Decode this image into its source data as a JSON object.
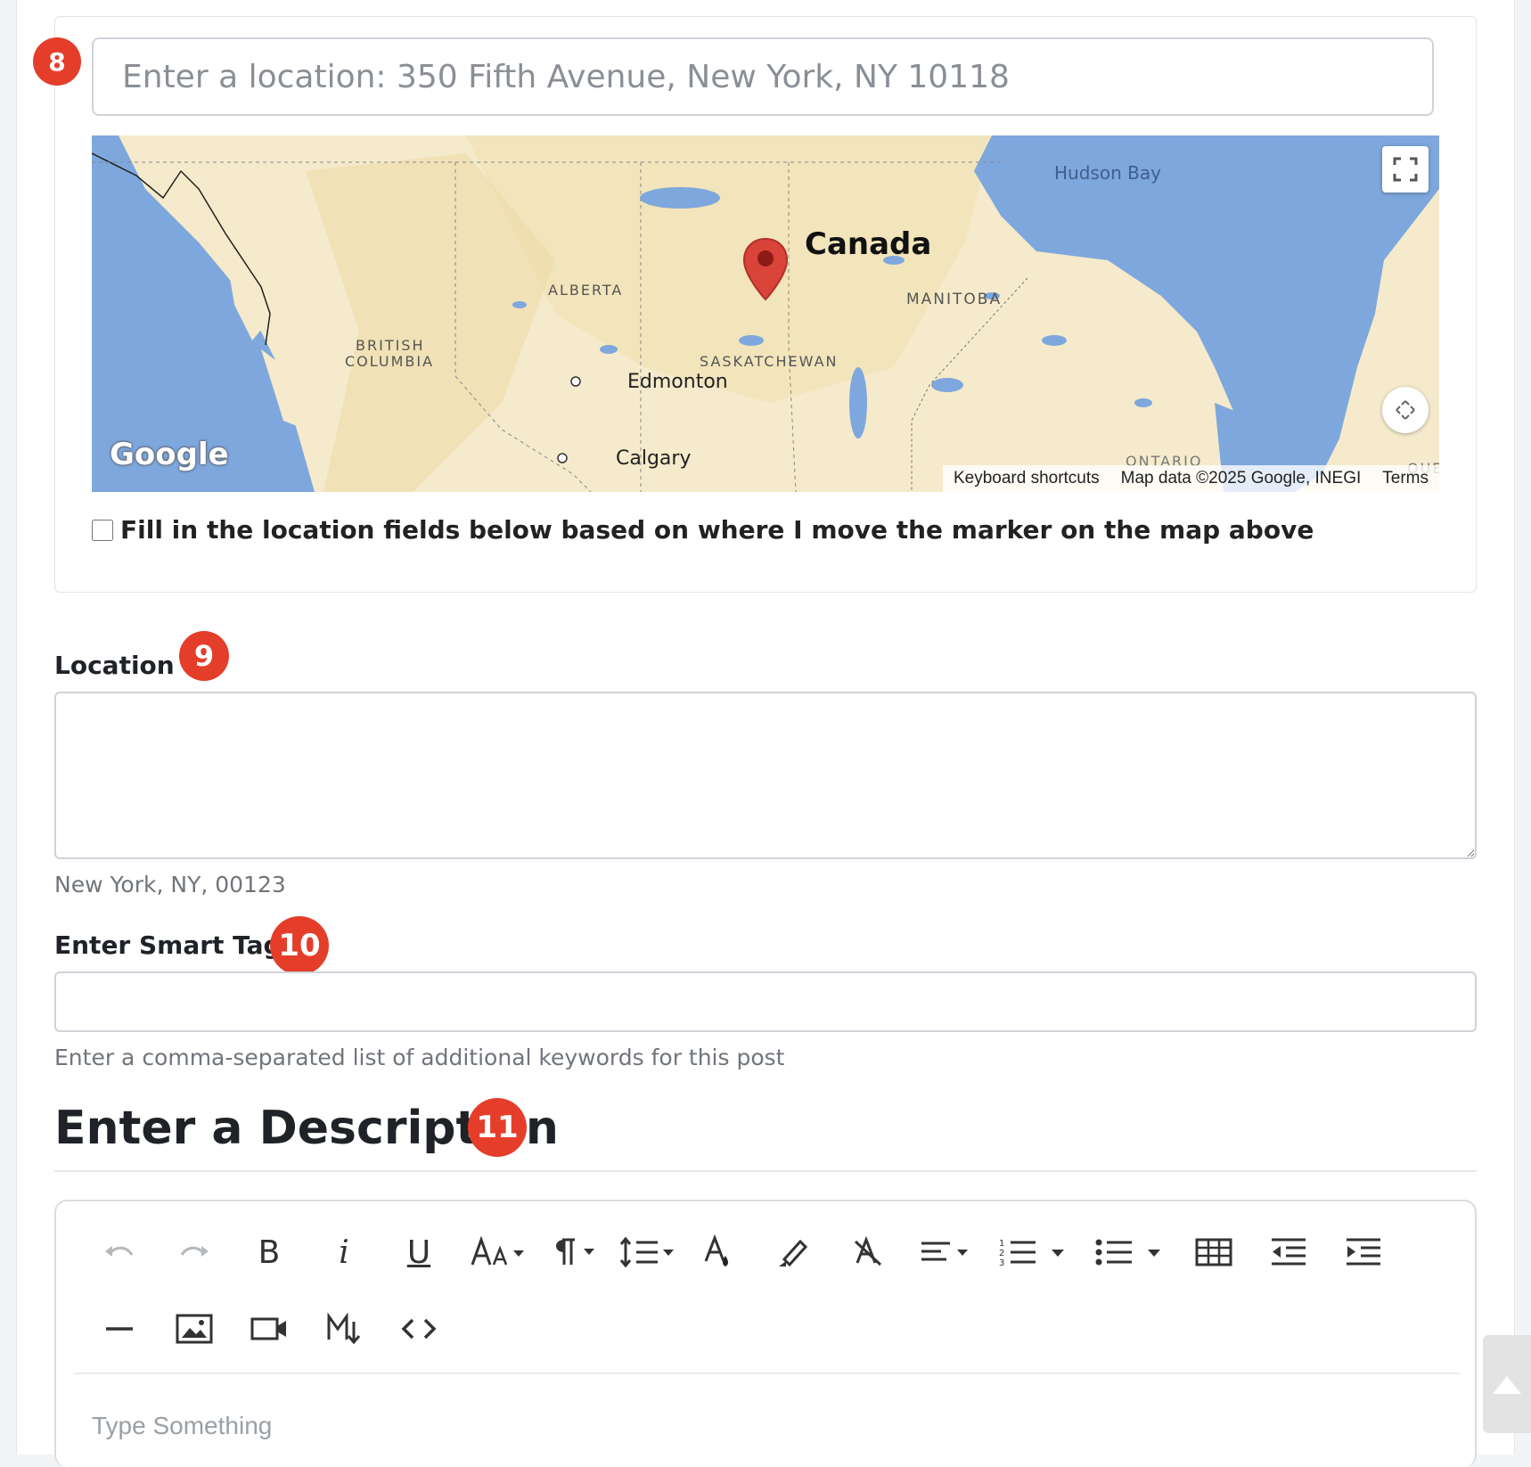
{
  "colors": {
    "accent_badge": "#e43e2b",
    "map_water": "#7ea7dd",
    "map_land": "#f5eacb",
    "marker": "#d9433a"
  },
  "map_section": {
    "step_badge": "8",
    "search_placeholder": "Enter a location: 350 Fifth Avenue, New York, NY 10118",
    "map_labels": {
      "hudson_bay": "Hudson Bay",
      "canada": "Canada",
      "alberta": "ALBERTA",
      "manitoba": "MANITOBA",
      "british_columbia_1": "BRITISH",
      "british_columbia_2": "COLUMBIA",
      "saskatchewan": "SASKATCHEWAN",
      "edmonton": "Edmonton",
      "calgary": "Calgary",
      "ontario": "ONTARIO",
      "quebec_partial": "QUE",
      "google_logo": "Google"
    },
    "attribution": {
      "keyboard_shortcuts": "Keyboard shortcuts",
      "map_data": "Map data ©2025 Google, INEGI",
      "terms": "Terms"
    },
    "icons": [
      "fullscreen-icon",
      "recenter-icon",
      "map-marker-icon"
    ],
    "checkbox_label": "Fill in the location fields below based on where I move the marker on the map above",
    "checkbox_checked": false
  },
  "location": {
    "label": "Location",
    "step_badge": "9",
    "value": "",
    "help": "New York, NY, 00123"
  },
  "smart_tags": {
    "label": "Enter Smart Tags",
    "step_badge": "10",
    "value": "",
    "help": "Enter a comma-separated list of additional keywords for this post"
  },
  "description": {
    "title": "Enter a Description",
    "step_badge": "11",
    "toolbar_icons": [
      "undo-icon",
      "redo-icon",
      "bold-icon",
      "italic-icon",
      "underline-icon",
      "font-size-icon",
      "paragraph-format-icon",
      "line-height-icon",
      "text-color-icon",
      "highlight-icon",
      "clear-formatting-icon",
      "align-icon",
      "ordered-list-icon",
      "ordered-list-options-icon",
      "unordered-list-icon",
      "unordered-list-options-icon",
      "table-icon",
      "outdent-icon",
      "indent-icon",
      "horizontal-line-icon",
      "insert-image-icon",
      "insert-video-icon",
      "markdown-icon",
      "code-view-icon"
    ],
    "bold_glyph": "B",
    "italic_glyph": "i",
    "underline_glyph": "U",
    "placeholder": "Type Something"
  }
}
